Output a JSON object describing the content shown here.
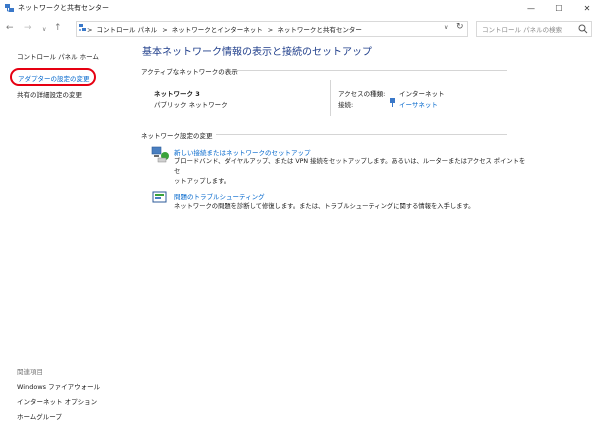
{
  "window": {
    "title": "ネットワークと共有センター",
    "minimize_glyph": "—",
    "maximize_glyph": "☐",
    "close_glyph": "✕"
  },
  "address": {
    "breadcrumb_sep": ">",
    "crumbs": [
      "コントロール パネル",
      "ネットワークとインターネット",
      "ネットワークと共有センター"
    ],
    "search_placeholder": "コントロール パネルの検索"
  },
  "sidebar": {
    "home": "コントロール パネル ホーム",
    "adapter_settings": "アダプターの設定の変更",
    "sharing_settings": "共有の詳細設定の変更",
    "related_header": "関連項目",
    "related": [
      "Windows ファイアウォール",
      "インターネット オプション",
      "ホームグループ"
    ]
  },
  "main": {
    "title": "基本ネットワーク情報の表示と接続のセットアップ",
    "active_networks_label": "アクティブなネットワークの表示",
    "network_name": "ネットワーク 3",
    "network_type": "パブリック ネットワーク",
    "access_type_label": "アクセスの種類:",
    "access_type_value": "インターネット",
    "connection_label": "接続:",
    "connection_value": "イーサネット",
    "change_settings_label": "ネットワーク設定の変更",
    "setup_link": "新しい接続またはネットワークのセットアップ",
    "setup_desc_1": "ブロードバンド、ダイヤルアップ、または VPN 接続をセットアップします。あるいは、ルーターまたはアクセス ポイントをセ",
    "setup_desc_2": "ットアップします。",
    "troubleshoot_link": "問題のトラブルシューティング",
    "troubleshoot_desc": "ネットワークの問題を診断して修復します。または、トラブルシューティングに関する情報を入手します。"
  }
}
